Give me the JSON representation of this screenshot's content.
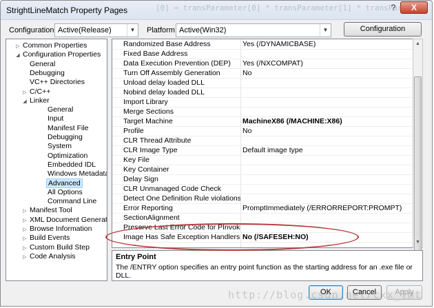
{
  "window": {
    "title": "StrightLineMatch Property Pages",
    "background_code": "[0] = transParameter[0] * transParameter[1] * transParame",
    "help_label": "?",
    "close_label": "X"
  },
  "toolbar": {
    "configuration_label": "Configuration:",
    "configuration_value": "Active(Release)",
    "platform_label": "Platform:",
    "platform_value": "Active(Win32)",
    "manager_label": "Configuration Manager..."
  },
  "tree": [
    {
      "label": "Common Properties",
      "toggle": "▷",
      "indent": 0
    },
    {
      "label": "Configuration Properties",
      "toggle": "◢",
      "indent": 0
    },
    {
      "label": "General",
      "toggle": "",
      "indent": 1
    },
    {
      "label": "Debugging",
      "toggle": "",
      "indent": 1
    },
    {
      "label": "VC++ Directories",
      "toggle": "",
      "indent": 1
    },
    {
      "label": "C/C++",
      "toggle": "▷",
      "indent": 1
    },
    {
      "label": "Linker",
      "toggle": "◢",
      "indent": 1
    },
    {
      "label": "General",
      "toggle": "",
      "indent": 2
    },
    {
      "label": "Input",
      "toggle": "",
      "indent": 2
    },
    {
      "label": "Manifest File",
      "toggle": "",
      "indent": 2
    },
    {
      "label": "Debugging",
      "toggle": "",
      "indent": 2
    },
    {
      "label": "System",
      "toggle": "",
      "indent": 2
    },
    {
      "label": "Optimization",
      "toggle": "",
      "indent": 2
    },
    {
      "label": "Embedded IDL",
      "toggle": "",
      "indent": 2
    },
    {
      "label": "Windows Metadata",
      "toggle": "",
      "indent": 2
    },
    {
      "label": "Advanced",
      "toggle": "",
      "indent": 2,
      "selected": true
    },
    {
      "label": "All Options",
      "toggle": "",
      "indent": 2
    },
    {
      "label": "Command Line",
      "toggle": "",
      "indent": 2
    },
    {
      "label": "Manifest Tool",
      "toggle": "▷",
      "indent": 1
    },
    {
      "label": "XML Document Generator",
      "toggle": "▷",
      "indent": 1
    },
    {
      "label": "Browse Information",
      "toggle": "▷",
      "indent": 1
    },
    {
      "label": "Build Events",
      "toggle": "▷",
      "indent": 1
    },
    {
      "label": "Custom Build Step",
      "toggle": "▷",
      "indent": 1
    },
    {
      "label": "Code Analysis",
      "toggle": "▷",
      "indent": 1
    }
  ],
  "properties": [
    {
      "name": "Randomized Base Address",
      "value": "Yes (/DYNAMICBASE)",
      "bold": false
    },
    {
      "name": "Fixed Base Address",
      "value": "",
      "bold": false
    },
    {
      "name": "Data Execution Prevention (DEP)",
      "value": "Yes (/NXCOMPAT)",
      "bold": false
    },
    {
      "name": "Turn Off Assembly Generation",
      "value": "No",
      "bold": false
    },
    {
      "name": "Unload delay loaded DLL",
      "value": "",
      "bold": false
    },
    {
      "name": "Nobind delay loaded DLL",
      "value": "",
      "bold": false
    },
    {
      "name": "Import Library",
      "value": "",
      "bold": false
    },
    {
      "name": "Merge Sections",
      "value": "",
      "bold": false
    },
    {
      "name": "Target Machine",
      "value": "MachineX86 (/MACHINE:X86)",
      "bold": true
    },
    {
      "name": "Profile",
      "value": "No",
      "bold": false
    },
    {
      "name": "CLR Thread Attribute",
      "value": "",
      "bold": false
    },
    {
      "name": "CLR Image Type",
      "value": "Default image type",
      "bold": false
    },
    {
      "name": "Key File",
      "value": "",
      "bold": false
    },
    {
      "name": "Key Container",
      "value": "",
      "bold": false
    },
    {
      "name": "Delay Sign",
      "value": "",
      "bold": false
    },
    {
      "name": "CLR Unmanaged Code Check",
      "value": "",
      "bold": false
    },
    {
      "name": "Detect One Definition Rule violations",
      "value": "",
      "bold": false
    },
    {
      "name": "Error Reporting",
      "value": "PromptImmediately (/ERRORREPORT:PROMPT)",
      "bold": false
    },
    {
      "name": "SectionAlignment",
      "value": "",
      "bold": false
    },
    {
      "name": "Preserve Last Error Code for PInvoke Calls",
      "value": "",
      "bold": false
    },
    {
      "name": "Image Has Safe Exception Handlers",
      "value": "No (/SAFESEH:NO)",
      "bold": true
    }
  ],
  "description": {
    "title": "Entry Point",
    "text": "The /ENTRY option specifies an entry point function as the starting address for an .exe file or DLL."
  },
  "buttons": {
    "ok": "OK",
    "cancel": "Cancel",
    "apply": "Apply"
  },
  "watermark": "http://blog.csdn.net/cxx_lmt",
  "colors": {
    "highlight_oval": "#b33a3a",
    "selection": "#cce8ff"
  }
}
